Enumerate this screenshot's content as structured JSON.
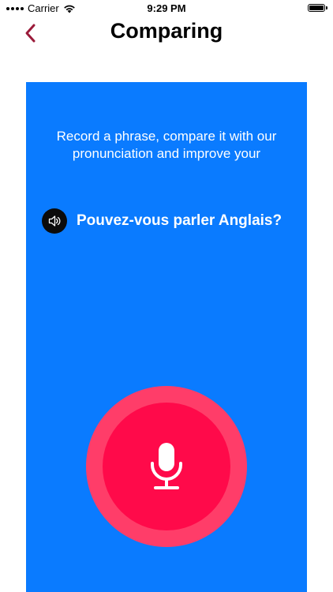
{
  "status_bar": {
    "carrier": "Carrier",
    "time": "9:29 PM"
  },
  "nav": {
    "title": "Comparing",
    "back_icon": "chevron-left-icon"
  },
  "card": {
    "instruction": "Record a phrase, compare it with our pronunciation and improve your",
    "phrase": "Pouvez-vous parler Anglais?",
    "speaker_icon": "speaker-icon",
    "record_icon": "microphone-icon"
  },
  "colors": {
    "card_background": "#0a7bff",
    "record_outer": "#ff3d69",
    "record_inner": "#ff0a4a",
    "back_chevron": "#9b1b3a"
  }
}
